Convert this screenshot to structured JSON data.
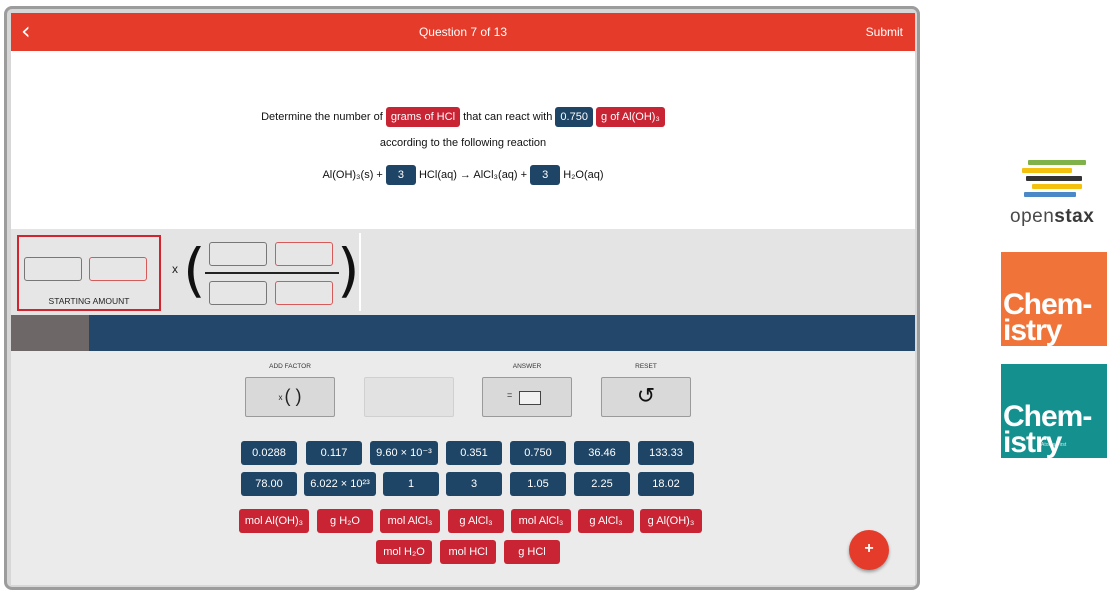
{
  "header": {
    "back_label": "‹",
    "question_counter": "Question 7 of 13",
    "submit_label": "Submit"
  },
  "problem": {
    "prefix": "Determine the number of",
    "target_unit": "grams of HCl",
    "middle": "that can react with",
    "given_value": "0.750",
    "given_unit": "g of Al(OH)₃",
    "line2": "according to the following reaction",
    "reaction": {
      "reactant1": "Al(OH)₃(s) +",
      "coef_hcl": "3",
      "reactant2": "HCl(aq) → AlCl₃(aq) +",
      "coef_h2o": "3",
      "product2": "H₂O(aq)"
    }
  },
  "workspace": {
    "starting_amount_label": "STARTING AMOUNT",
    "times_symbol": "x",
    "open_paren": "(",
    "close_paren": ")"
  },
  "controls": {
    "add_factor_label": "ADD FACTOR",
    "add_factor_small_x": "x",
    "add_factor_parens": "(   )",
    "answer_label": "ANSWER",
    "answer_equals": "=",
    "reset_label": "RESET",
    "reset_icon": "↺"
  },
  "number_tiles_row1": [
    "0.0288",
    "0.117",
    "9.60 × 10⁻³",
    "0.351",
    "0.750",
    "36.46",
    "133.33"
  ],
  "number_tiles_row2": [
    "78.00",
    "6.022 × 10²³",
    "1",
    "3",
    "1.05",
    "2.25",
    "18.02"
  ],
  "unit_tiles_row1": [
    "mol Al(OH)₃",
    "g H₂O",
    "mol AlCl₃",
    "g AlCl₃",
    "mol AlCl₃",
    "g AlCl₃",
    "g Al(OH)₃"
  ],
  "unit_tiles_row2": [
    "mol H₂O",
    "mol HCl",
    "g HCl"
  ],
  "fab_label": "+",
  "sidebar": {
    "openstax_light": "open",
    "openstax_bold": "stax",
    "cover1_title": "Chem-\nistry",
    "cover2_title": "Chem-\nistry",
    "cover2_subtitle": "Atoms First",
    "cover1_color": "#f0743a",
    "cover2_color": "#14918f"
  },
  "colors": {
    "header_red": "#e53b2a",
    "unit_red": "#c82434",
    "number_navy": "#1f4566"
  }
}
